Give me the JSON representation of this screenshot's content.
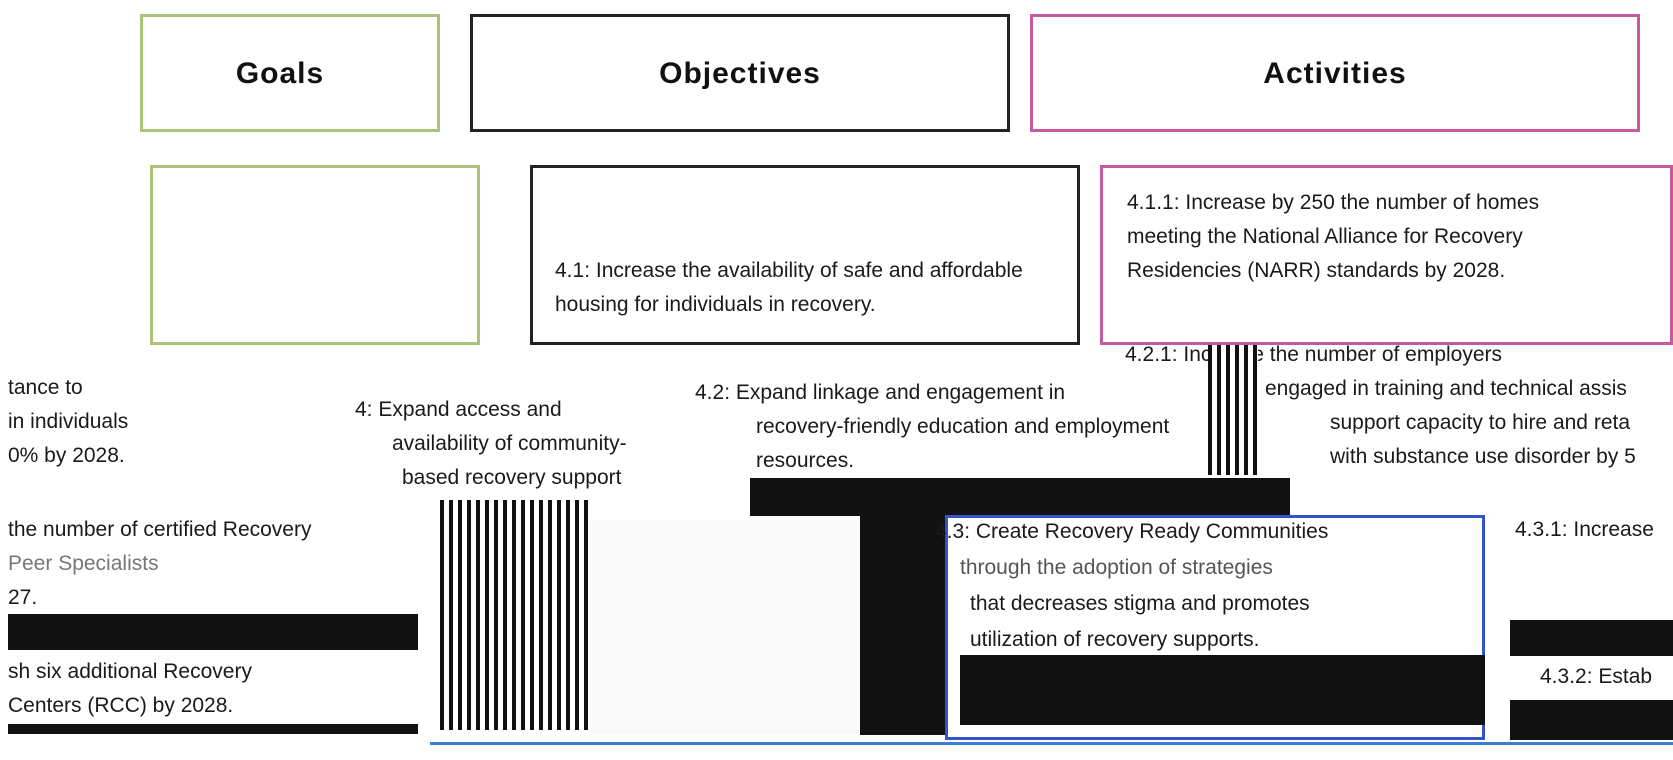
{
  "headers": {
    "goals": "Goals",
    "objectives": "Objectives",
    "activities": "Activities"
  },
  "objectives": {
    "o41": "4.1: Increase the availability of safe and affordable housing for individuals in recovery.",
    "o42_line1": "4.2: Expand linkage and engagement in",
    "o42_line2": "recovery-friendly education and employment",
    "o42_line3": "resources.",
    "o43_line1": "4.3: Create Recovery Ready Communities",
    "o43_line2": "through the adoption of strategies",
    "o43_line3": "that decreases stigma and promotes",
    "o43_line4": "utilization of recovery supports."
  },
  "goal": {
    "line1": "4: Expand access and",
    "line2": "availability of community-",
    "line3": "based recovery support"
  },
  "activities": {
    "a411_line1": "4.1.1: Increase by 250 the number of homes",
    "a411_line2": "meeting the National Alliance for Recovery",
    "a411_line3": "Residencies (NARR) standards by 2028.",
    "a421_line1": "4.2.1: Increase the number of employers",
    "a421_line2": "engaged in training and technical assis",
    "a421_line3": "support capacity to hire and reta",
    "a421_line4": "with substance use disorder by 5",
    "a431": "4.3.1: Increase",
    "a432": "4.3.2: Estab"
  },
  "left_fragments": {
    "f1": "tance to",
    "f2": "in individuals",
    "f3": "0% by 2028.",
    "f4": "the number of certified Recovery",
    "f5": "Peer Specialists",
    "f6": "27.",
    "f7": "sh six additional Recovery",
    "f8": "Centers (RCC) by 2028."
  }
}
